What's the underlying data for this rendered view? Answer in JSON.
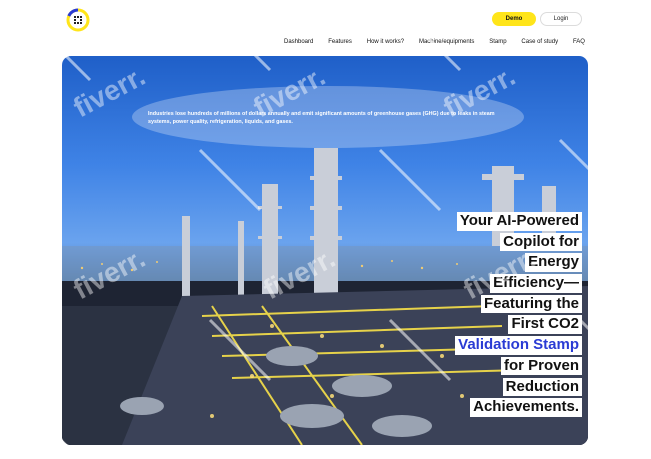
{
  "header": {
    "logo_icon": "brand-logo-icon",
    "demo_label": "Demo",
    "login_label": "Login",
    "nav": [
      "Dashboard",
      "Features",
      "How it works?",
      "Machine/equipments",
      "Stamp",
      "Case of study",
      "FAQ"
    ]
  },
  "hero": {
    "intro": "Industries lose hundreds of millions of dollars annually and emit significant amounts of greenhouse gases (GHG) due to leaks in steam systems, power quality, refrigeration, liquids, and gases.",
    "headline_lines": [
      "Your AI-Powered",
      "Copilot for",
      "Energy",
      "Efficiency—",
      "Featuring the",
      "First CO2",
      "Validation Stamp",
      "for Proven",
      "Reduction",
      "Achievements."
    ],
    "accent_line_index": 6
  },
  "watermark": {
    "text": "fiverr."
  },
  "colors": {
    "demo_button": "#ffe51a",
    "headline_accent": "#2a3bd4",
    "logo_yellow": "#ffe51a",
    "logo_blue": "#2a3bd4"
  }
}
